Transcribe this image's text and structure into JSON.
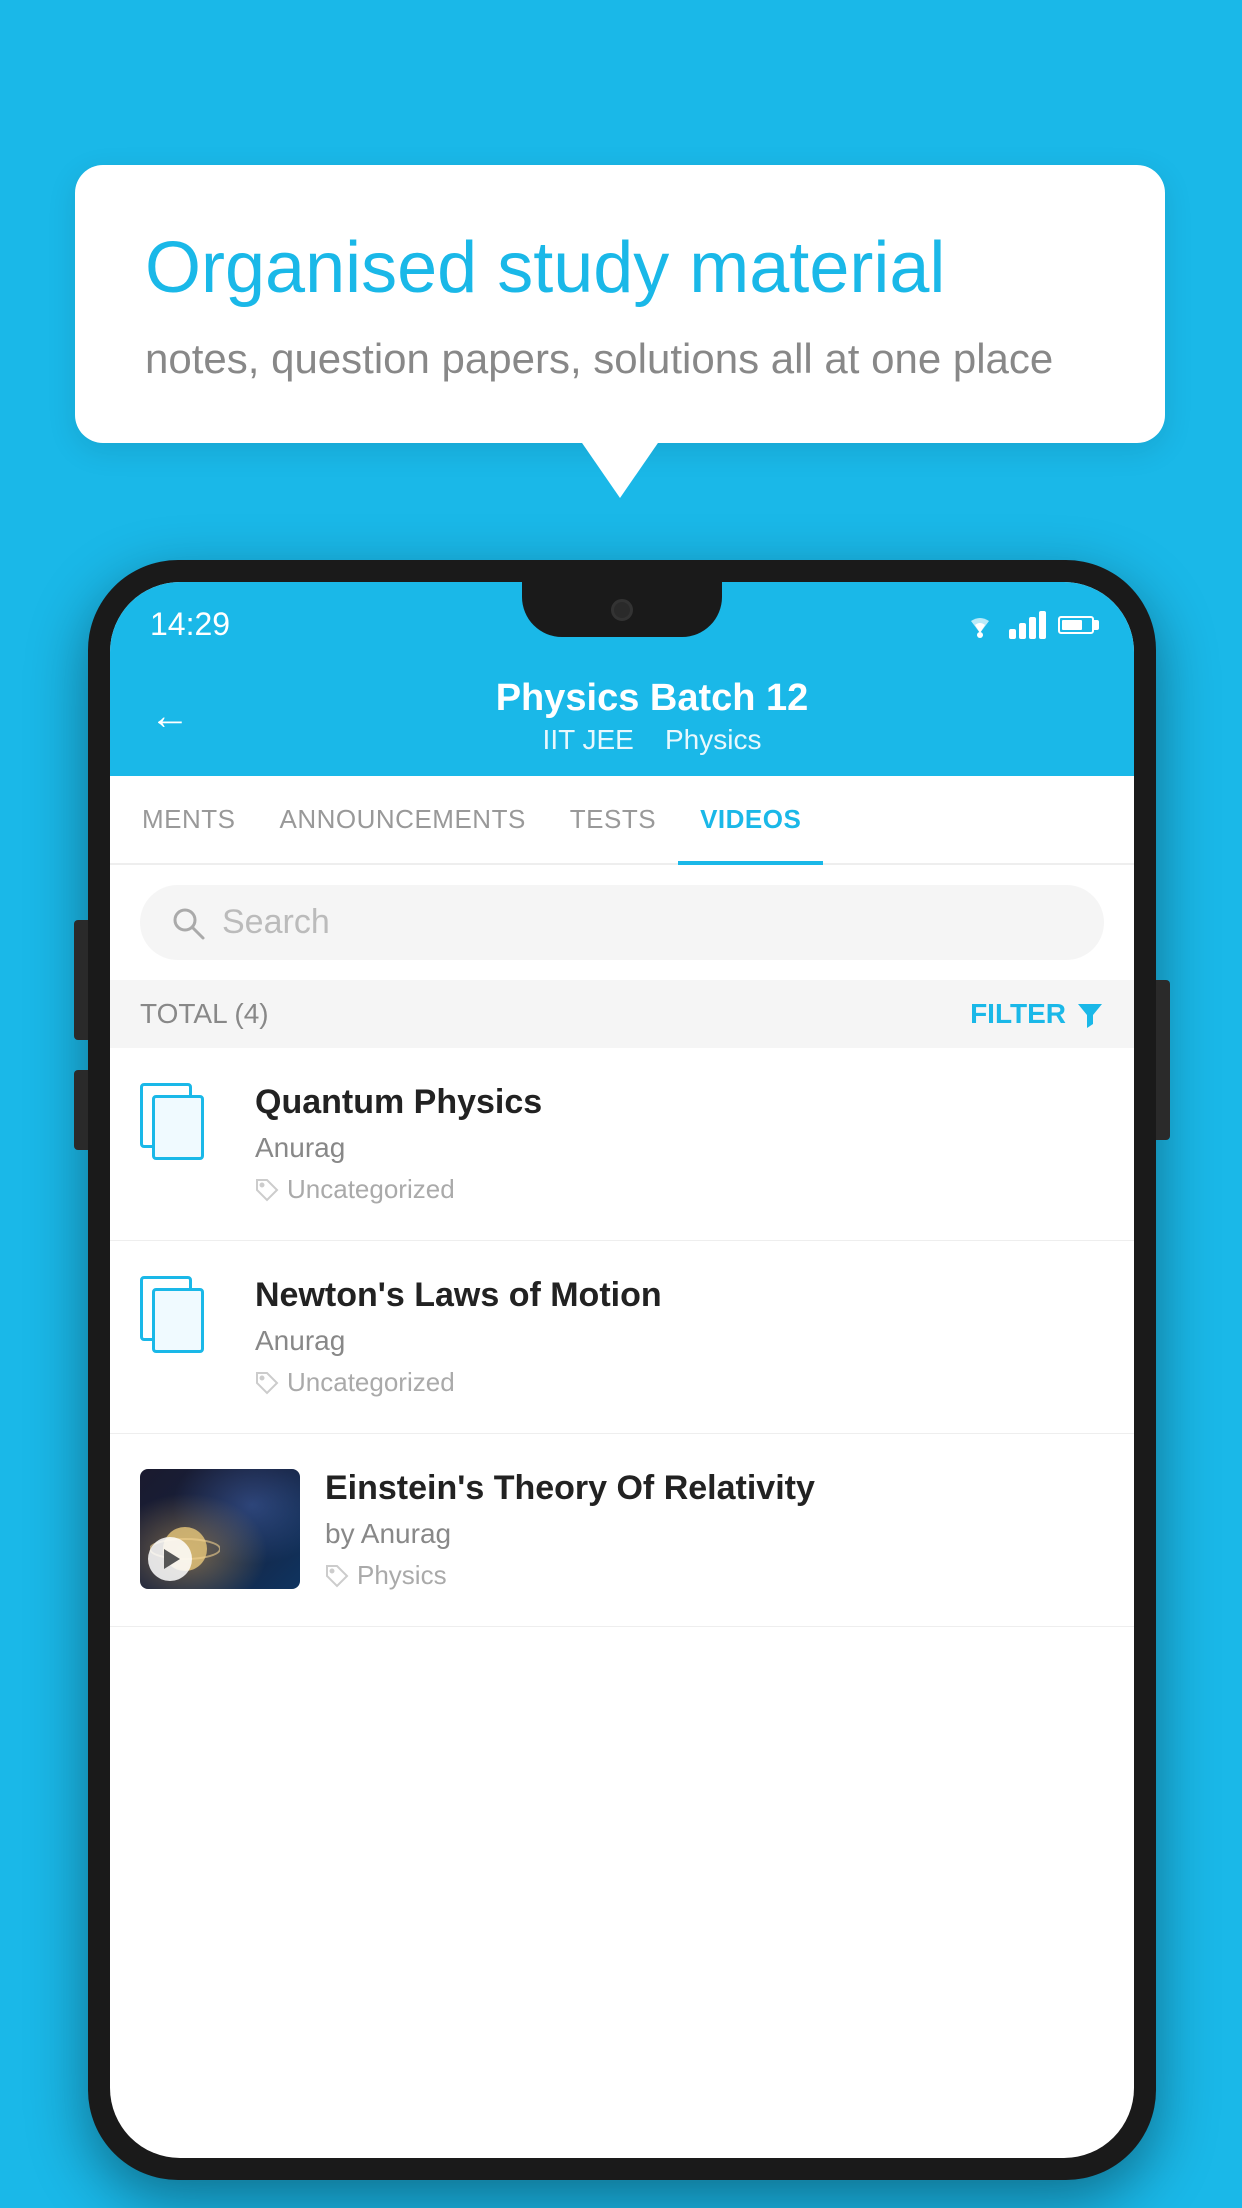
{
  "background_color": "#1ab8e8",
  "bubble": {
    "title": "Organised study material",
    "subtitle": "notes, question papers, solutions all at one place"
  },
  "status_bar": {
    "time": "14:29",
    "wifi": "▾",
    "signal": "▲",
    "battery": "▓"
  },
  "header": {
    "back_label": "←",
    "title": "Physics Batch 12",
    "subtitle_tag1": "IIT JEE",
    "subtitle_tag2": "Physics"
  },
  "tabs": [
    {
      "label": "MENTS",
      "active": false
    },
    {
      "label": "ANNOUNCEMENTS",
      "active": false
    },
    {
      "label": "TESTS",
      "active": false
    },
    {
      "label": "VIDEOS",
      "active": true
    }
  ],
  "search": {
    "placeholder": "Search"
  },
  "filter_bar": {
    "total_label": "TOTAL (4)",
    "filter_label": "FILTER"
  },
  "videos": [
    {
      "id": 1,
      "title": "Quantum Physics",
      "author": "Anurag",
      "tag": "Uncategorized",
      "has_thumbnail": false
    },
    {
      "id": 2,
      "title": "Newton's Laws of Motion",
      "author": "Anurag",
      "tag": "Uncategorized",
      "has_thumbnail": false
    },
    {
      "id": 3,
      "title": "Einstein's Theory Of Relativity",
      "author": "by Anurag",
      "tag": "Physics",
      "has_thumbnail": true
    }
  ]
}
